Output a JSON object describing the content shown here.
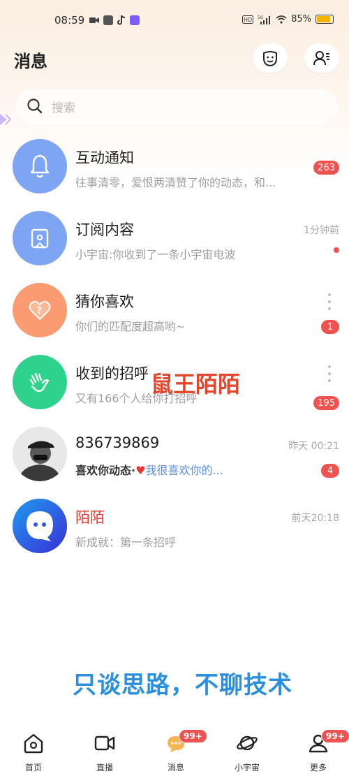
{
  "status_bar": {
    "time": "08:59",
    "battery_percent": "85%",
    "battery_level": 0.85,
    "icons": [
      "video-icon",
      "douyin-icon",
      "tiktok-icon",
      "app-icon",
      "hd-icon",
      "5g-signal-icon",
      "wifi-icon",
      "battery-icon"
    ]
  },
  "header": {
    "title": "消息",
    "buttons": [
      "face-icon",
      "contacts-icon"
    ]
  },
  "search": {
    "placeholder": "搜索"
  },
  "messages": [
    {
      "title": "互动通知",
      "subtitle": "往事清零，爱恨两清赞了你的动态，和...",
      "time": "",
      "badge": "263",
      "avatar": "bell-icon",
      "avatar_color": "#7ea4f4"
    },
    {
      "title": "订阅内容",
      "subtitle": "小宇宙:你收到了一条小宇宙电波",
      "time": "1分钟前",
      "badge": "",
      "dot": true,
      "avatar": "subscription-icon",
      "avatar_color": "#7ea4f4"
    },
    {
      "title": "猜你喜欢",
      "subtitle": "你们的匹配度超高哟~",
      "time": "",
      "badge": "1",
      "avatar": "heart-question-icon",
      "avatar_color": "#fb9b72"
    },
    {
      "title": "收到的招呼",
      "subtitle": "又有166个人给你打招呼",
      "time": "",
      "badge": "195",
      "avatar": "wave-hand-icon",
      "avatar_color": "#2fd28d"
    },
    {
      "title": "836739869",
      "subtitle_bold": "喜欢你动态·",
      "subtitle_link": "我很喜欢你的...",
      "time": "昨天 00:21",
      "badge": "4",
      "avatar": "user-photo",
      "avatar_color": "#dcdcdc"
    },
    {
      "title": "陌陌",
      "subtitle": "新成就：第一条招呼",
      "time": "前天20:18",
      "badge": "",
      "avatar": "momo-logo-icon",
      "avatar_color": "#2f55e0"
    }
  ],
  "overlays": {
    "watermark": "鼠王陌陌",
    "banner": "只谈思路，不聊技术"
  },
  "tabbar": {
    "items": [
      {
        "label": "首页",
        "icon": "home-icon",
        "badge": ""
      },
      {
        "label": "直播",
        "icon": "live-video-icon",
        "badge": ""
      },
      {
        "label": "消息",
        "icon": "message-icon",
        "badge": "99+"
      },
      {
        "label": "小宇宙",
        "icon": "planet-icon",
        "badge": ""
      },
      {
        "label": "更多",
        "icon": "more-person-icon",
        "badge": "99+"
      }
    ]
  },
  "colors": {
    "accent_red": "#ef5350",
    "banner_blue": "#2b8fe0",
    "watermark_red": "#e2462d"
  }
}
